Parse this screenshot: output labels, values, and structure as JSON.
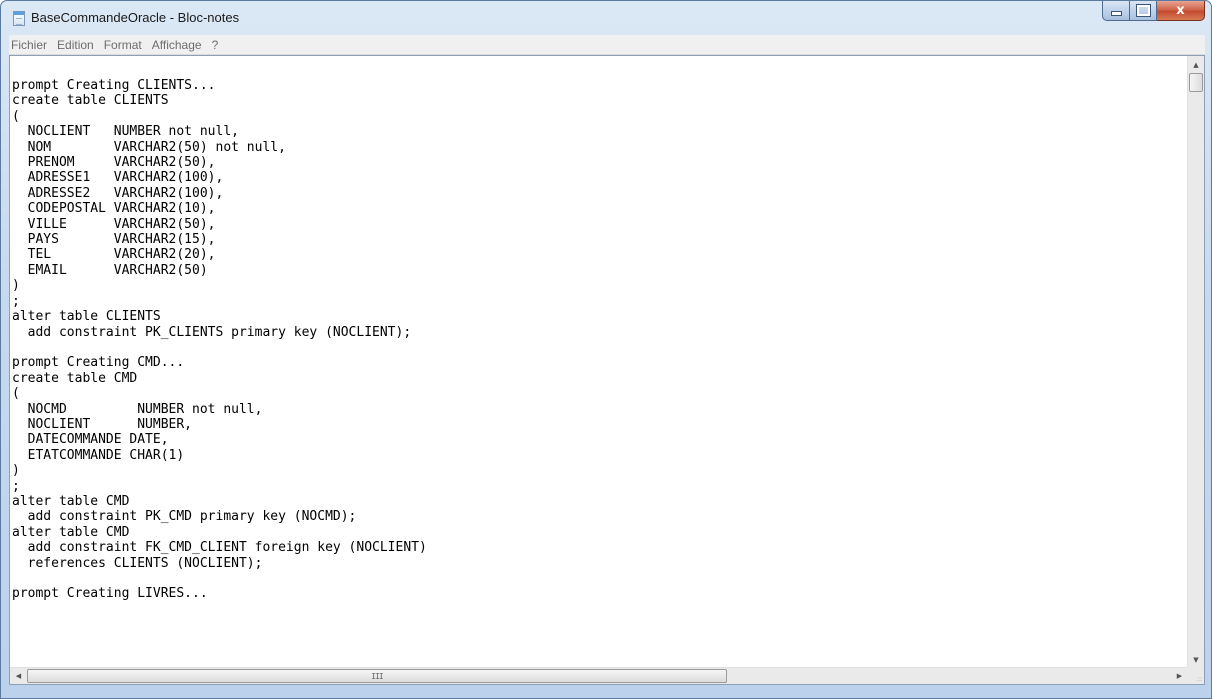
{
  "window": {
    "title": "BaseCommandeOracle - Bloc-notes",
    "app_icon": "notepad-icon",
    "caption_buttons": {
      "minimize": "minimize-icon",
      "maximize": "maximize-icon",
      "close_label": "x"
    }
  },
  "menubar": {
    "items": [
      "Fichier",
      "Edition",
      "Format",
      "Affichage",
      "?"
    ]
  },
  "editor": {
    "content": "prompt Creating CLIENTS...\ncreate table CLIENTS\n(\n  NOCLIENT   NUMBER not null,\n  NOM        VARCHAR2(50) not null,\n  PRENOM     VARCHAR2(50),\n  ADRESSE1   VARCHAR2(100),\n  ADRESSE2   VARCHAR2(100),\n  CODEPOSTAL VARCHAR2(10),\n  VILLE      VARCHAR2(50),\n  PAYS       VARCHAR2(15),\n  TEL        VARCHAR2(20),\n  EMAIL      VARCHAR2(50)\n)\n;\nalter table CLIENTS\n  add constraint PK_CLIENTS primary key (NOCLIENT);\n\nprompt Creating CMD...\ncreate table CMD\n(\n  NOCMD         NUMBER not null,\n  NOCLIENT      NUMBER,\n  DATECOMMANDE DATE,\n  ETATCOMMANDE CHAR(1)\n)\n;\nalter table CMD\n  add constraint PK_CMD primary key (NOCMD);\nalter table CMD\n  add constraint FK_CMD_CLIENT foreign key (NOCLIENT)\n  references CLIENTS (NOCLIENT);\n\nprompt Creating LIVRES..."
  },
  "scrollbars": {
    "horizontal_grip": "III",
    "up_arrow": "▲",
    "down_arrow": "▼",
    "left_arrow": "◀",
    "right_arrow": "▶",
    "size_grip": ".::"
  },
  "colors": {
    "title_bar": "#c7daef",
    "close_button": "#c44a2f",
    "menu_text": "#6d6d6d"
  }
}
